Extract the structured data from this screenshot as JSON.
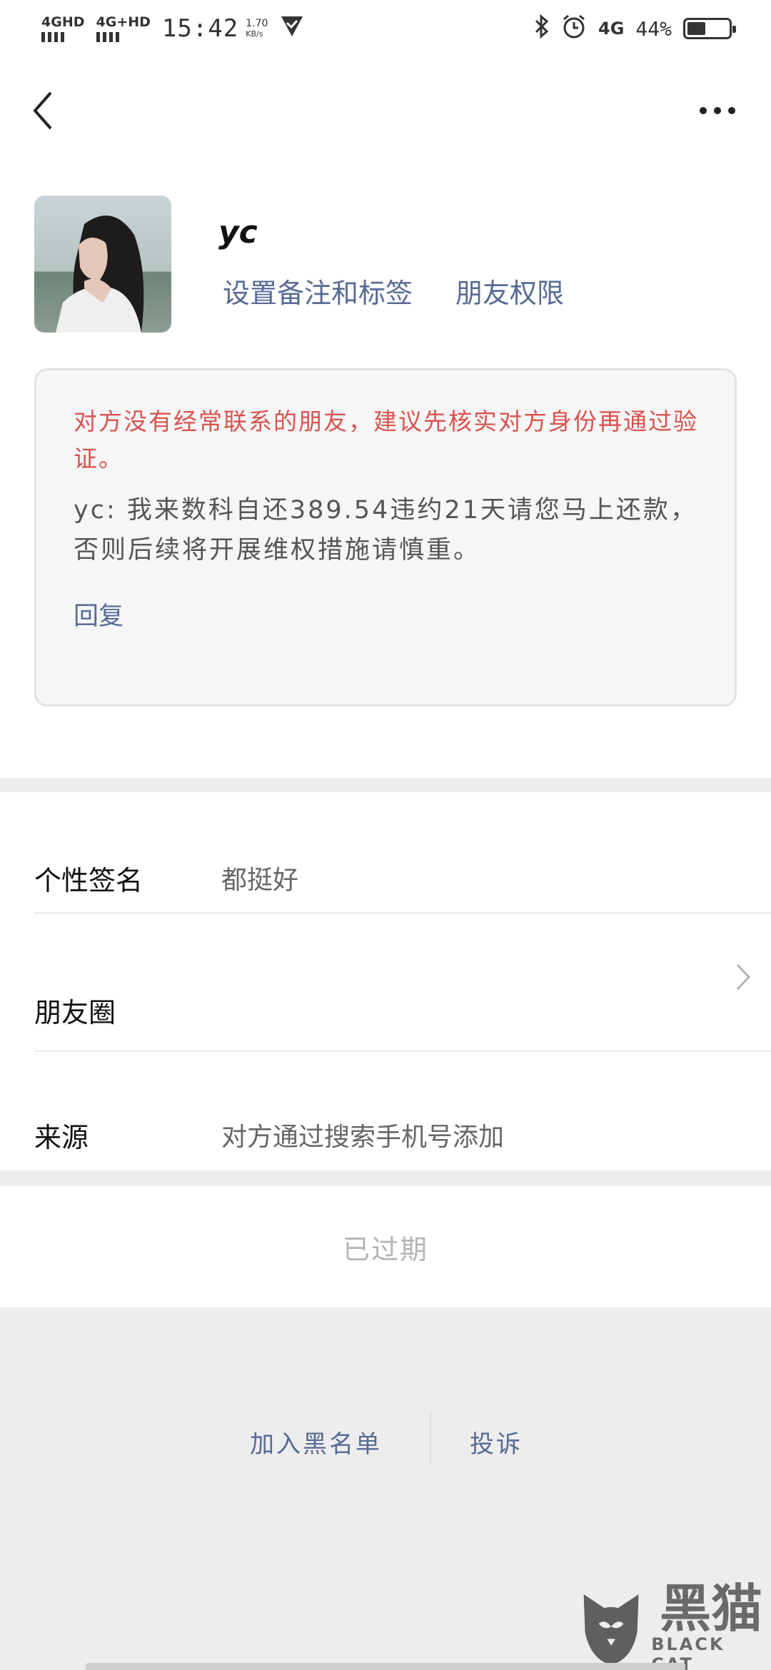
{
  "status_bar": {
    "net1": "4GHD",
    "net2": "4G+HD",
    "time": "15:42",
    "speed": "1.70",
    "speed_unit": "KB/s",
    "net3": "4G",
    "battery": "44%",
    "battery_level": 0.44
  },
  "profile": {
    "name": "yc",
    "set_remark": "设置备注和标签",
    "friend_permissions": "朋友权限"
  },
  "message": {
    "warning": "对方没有经常联系的朋友，建议先核实对方身份再通过验证。",
    "text": "yc: 我来数科自还389.54违约21天请您马上还款，否则后续将开展维权措施请慎重。",
    "reply": "回复"
  },
  "info": {
    "signature_label": "个性签名",
    "signature_value": "都挺好",
    "moments_label": "朋友圈",
    "source_label": "来源",
    "source_value": "对方通过搜索手机号添加"
  },
  "expired": "已过期",
  "actions": {
    "block": "加入黑名单",
    "report": "投诉"
  },
  "watermark": {
    "cn": "黑猫",
    "en": "BLACK CAT"
  }
}
